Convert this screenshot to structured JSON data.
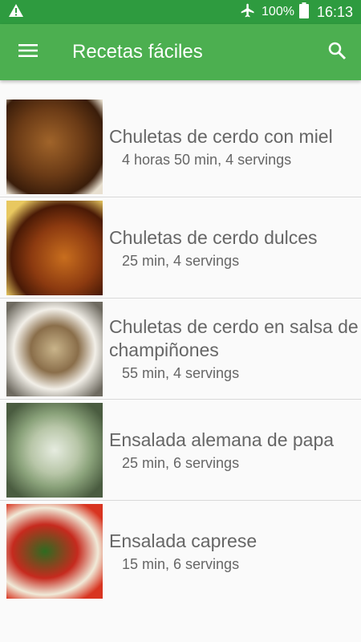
{
  "status_bar": {
    "battery_percent": "100%",
    "time": "16:13",
    "icons": [
      "warning-icon",
      "airplane-icon",
      "battery-icon"
    ]
  },
  "toolbar": {
    "title": "Recetas fáciles",
    "icons": [
      "menu-icon",
      "search-icon"
    ]
  },
  "colors": {
    "status_bar": "#2e9b3f",
    "toolbar": "#4caf50",
    "text": "#666666"
  },
  "recipes": [
    {
      "title": "Chuletas de cerdo con miel",
      "info": "4 horas 50 min, 4 servings"
    },
    {
      "title": "Chuletas de cerdo dulces",
      "info": "25 min, 4 servings"
    },
    {
      "title": "Chuletas de cerdo en salsa de champiñones",
      "info": "55 min, 4 servings"
    },
    {
      "title": "Ensalada alemana de papa",
      "info": "25 min, 6 servings"
    },
    {
      "title": "Ensalada caprese",
      "info": "15 min, 6 servings"
    }
  ]
}
